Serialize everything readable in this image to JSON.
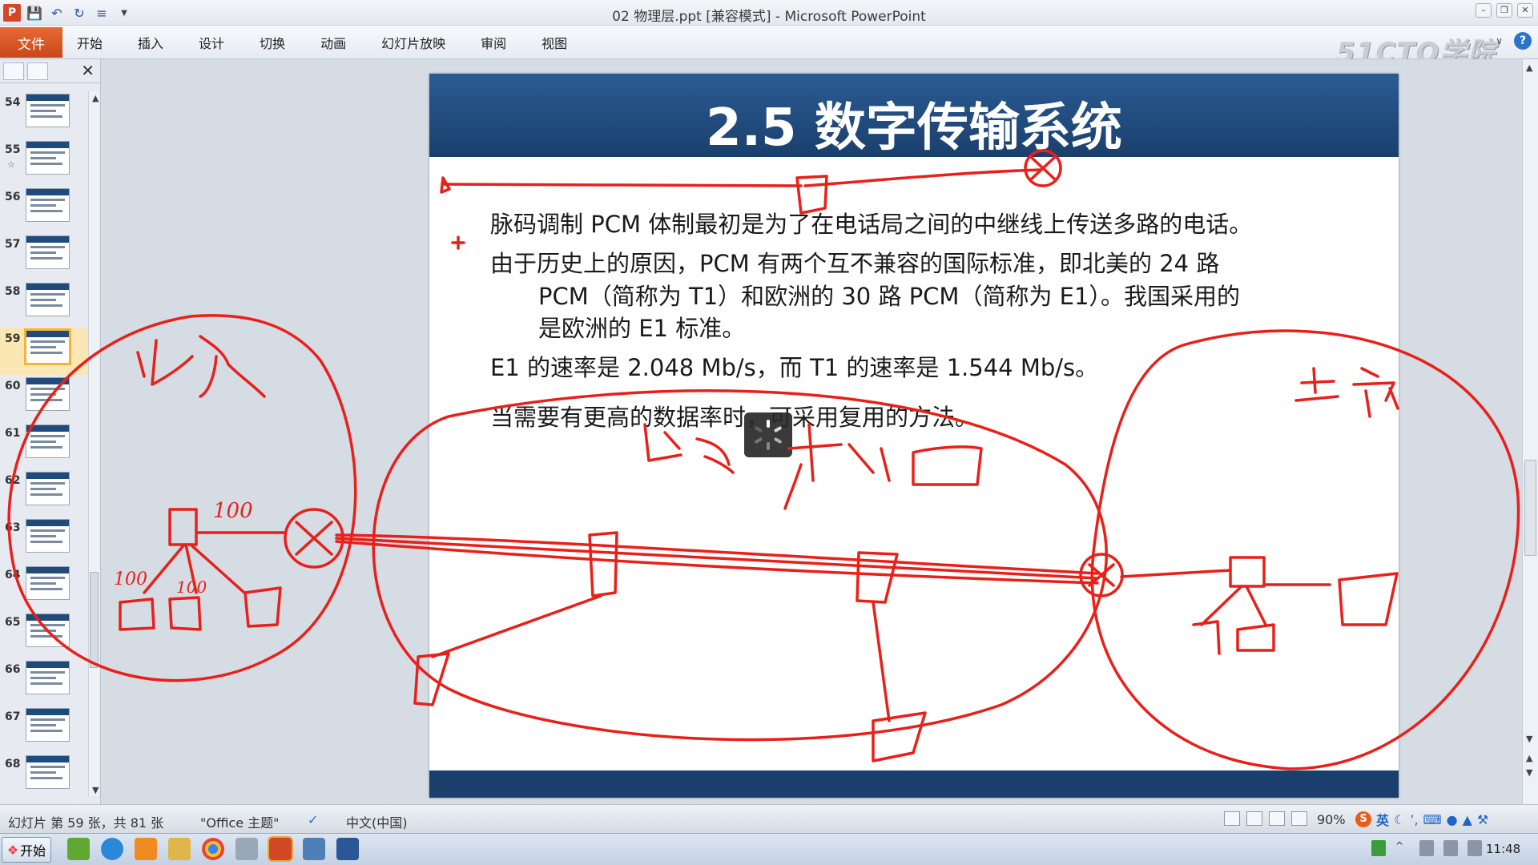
{
  "window": {
    "title": "02 物理层.ppt [兼容模式]  -  Microsoft PowerPoint",
    "app_icon": "P",
    "brand_watermark": "51CTO学院"
  },
  "ribbon": {
    "file_tab": "文件",
    "tabs": [
      "开始",
      "插入",
      "设计",
      "切换",
      "动画",
      "幻灯片放映",
      "审阅",
      "视图"
    ]
  },
  "thumbnails": [
    {
      "num": "54",
      "selected": false,
      "star": ""
    },
    {
      "num": "55",
      "selected": false,
      "star": "☆"
    },
    {
      "num": "56",
      "selected": false,
      "star": ""
    },
    {
      "num": "57",
      "selected": false,
      "star": ""
    },
    {
      "num": "58",
      "selected": false,
      "star": ""
    },
    {
      "num": "59",
      "selected": true,
      "star": ""
    },
    {
      "num": "60",
      "selected": false,
      "star": ""
    },
    {
      "num": "61",
      "selected": false,
      "star": ""
    },
    {
      "num": "62",
      "selected": false,
      "star": ""
    },
    {
      "num": "63",
      "selected": false,
      "star": ""
    },
    {
      "num": "64",
      "selected": false,
      "star": ""
    },
    {
      "num": "65",
      "selected": false,
      "star": ""
    },
    {
      "num": "66",
      "selected": false,
      "star": ""
    },
    {
      "num": "67",
      "selected": false,
      "star": ""
    },
    {
      "num": "68",
      "selected": false,
      "star": ""
    }
  ],
  "slide": {
    "title": "2.5 数字传输系统",
    "para1": "脉码调制 PCM 体制最初是为了在电话局之间的中继线上传送多路的电话。",
    "para2_line1": "由于历史上的原因，PCM 有两个互不兼容的国际标准，即北美的 24 路",
    "para2_line2": "PCM（简称为 T1）和欧洲的 30 路 PCM（简称为 E1）。我国采用的",
    "para2_line3": "是欧洲的 E1 标准。",
    "para3": "E1 的速率是 2.048 Mb/s，而 T1 的速率是 1.544 Mb/s。",
    "para4": "当需要有更高的数据率时，可采用复用的方法。"
  },
  "annotations": {
    "left_label": "北京",
    "right_label": "上海",
    "center_label": "电话广域网",
    "num1": "100",
    "num2": "100",
    "num3": "100",
    "ink_color": "#e8201a"
  },
  "statusbar": {
    "slide_info": "幻灯片 第 59 张，共 81 张",
    "theme": "\"Office 主题\"",
    "language": "中文(中国)",
    "zoom": "90%"
  },
  "ime": {
    "mode": "英"
  },
  "taskbar": {
    "start": "开始",
    "clock": "11:48"
  }
}
